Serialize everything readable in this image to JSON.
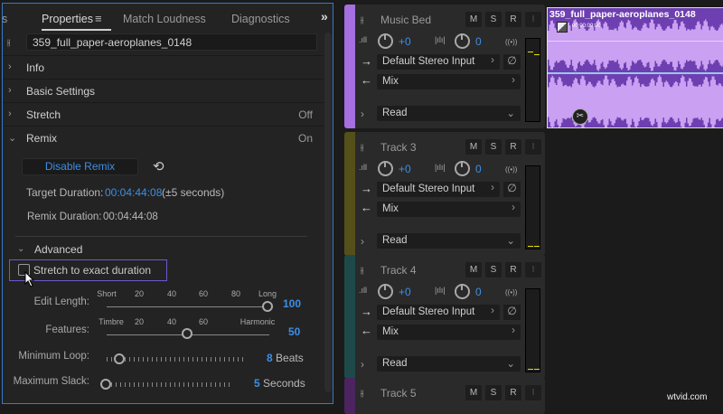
{
  "panel": {
    "tabs": [
      {
        "label": "s"
      },
      {
        "label": "Properties"
      },
      {
        "label": "Match Loudness"
      },
      {
        "label": "Diagnostics"
      }
    ],
    "more": "»",
    "clip_name": "359_full_paper-aeroplanes_0148",
    "sections": [
      {
        "label": "Info",
        "value": ""
      },
      {
        "label": "Basic Settings",
        "value": ""
      },
      {
        "label": "Stretch",
        "value": "Off"
      },
      {
        "label": "Remix",
        "value": "On"
      }
    ],
    "disable_remix": "Disable Remix",
    "target_label": "Target Duration:",
    "target_value": "00:04:44:08",
    "target_note": "(±5 seconds)",
    "remix_label": "Remix Duration:",
    "remix_value": "00:04:44:08",
    "advanced": "Advanced",
    "stretch_checkbox": "Stretch to exact duration",
    "stretch_checked": false,
    "edit_length": {
      "label": "Edit Length:",
      "ticks": [
        "Short",
        "20",
        "40",
        "60",
        "80",
        "Long"
      ],
      "value": "100"
    },
    "features": {
      "label": "Features:",
      "ticks": [
        "Timbre",
        "20",
        "40",
        "60",
        "Harmonic"
      ],
      "value": "50"
    },
    "min_loop": {
      "label": "Minimum Loop:",
      "value": "8",
      "unit": "Beats"
    },
    "max_slack": {
      "label": "Maximum Slack:",
      "value": "5",
      "unit": "Seconds"
    }
  },
  "tracks": [
    {
      "name": "Music Bed",
      "color": "#a56fe0",
      "volume": "+0",
      "pan": "0",
      "input": "Default Stereo Input",
      "output": "Mix",
      "automation": "Read"
    },
    {
      "name": "Track 3",
      "color": "#55501a",
      "volume": "+0",
      "pan": "0",
      "input": "Default Stereo Input",
      "output": "Mix",
      "automation": "Read"
    },
    {
      "name": "Track 4",
      "color": "#1d4a48",
      "volume": "+0",
      "pan": "0",
      "input": "Default Stereo Input",
      "output": "Mix",
      "automation": "Read"
    },
    {
      "name": "Track 5",
      "color": "#4b2460",
      "volume": "",
      "pan": "",
      "input": "",
      "output": "",
      "automation": ""
    }
  ],
  "track_buttons": {
    "mute": "M",
    "solo": "S",
    "record": "R",
    "input": "I"
  },
  "clip": {
    "name": "359_full_paper-aeroplanes_0148",
    "timecode": "00:00:00:00"
  },
  "watermark": "wtvid.com"
}
